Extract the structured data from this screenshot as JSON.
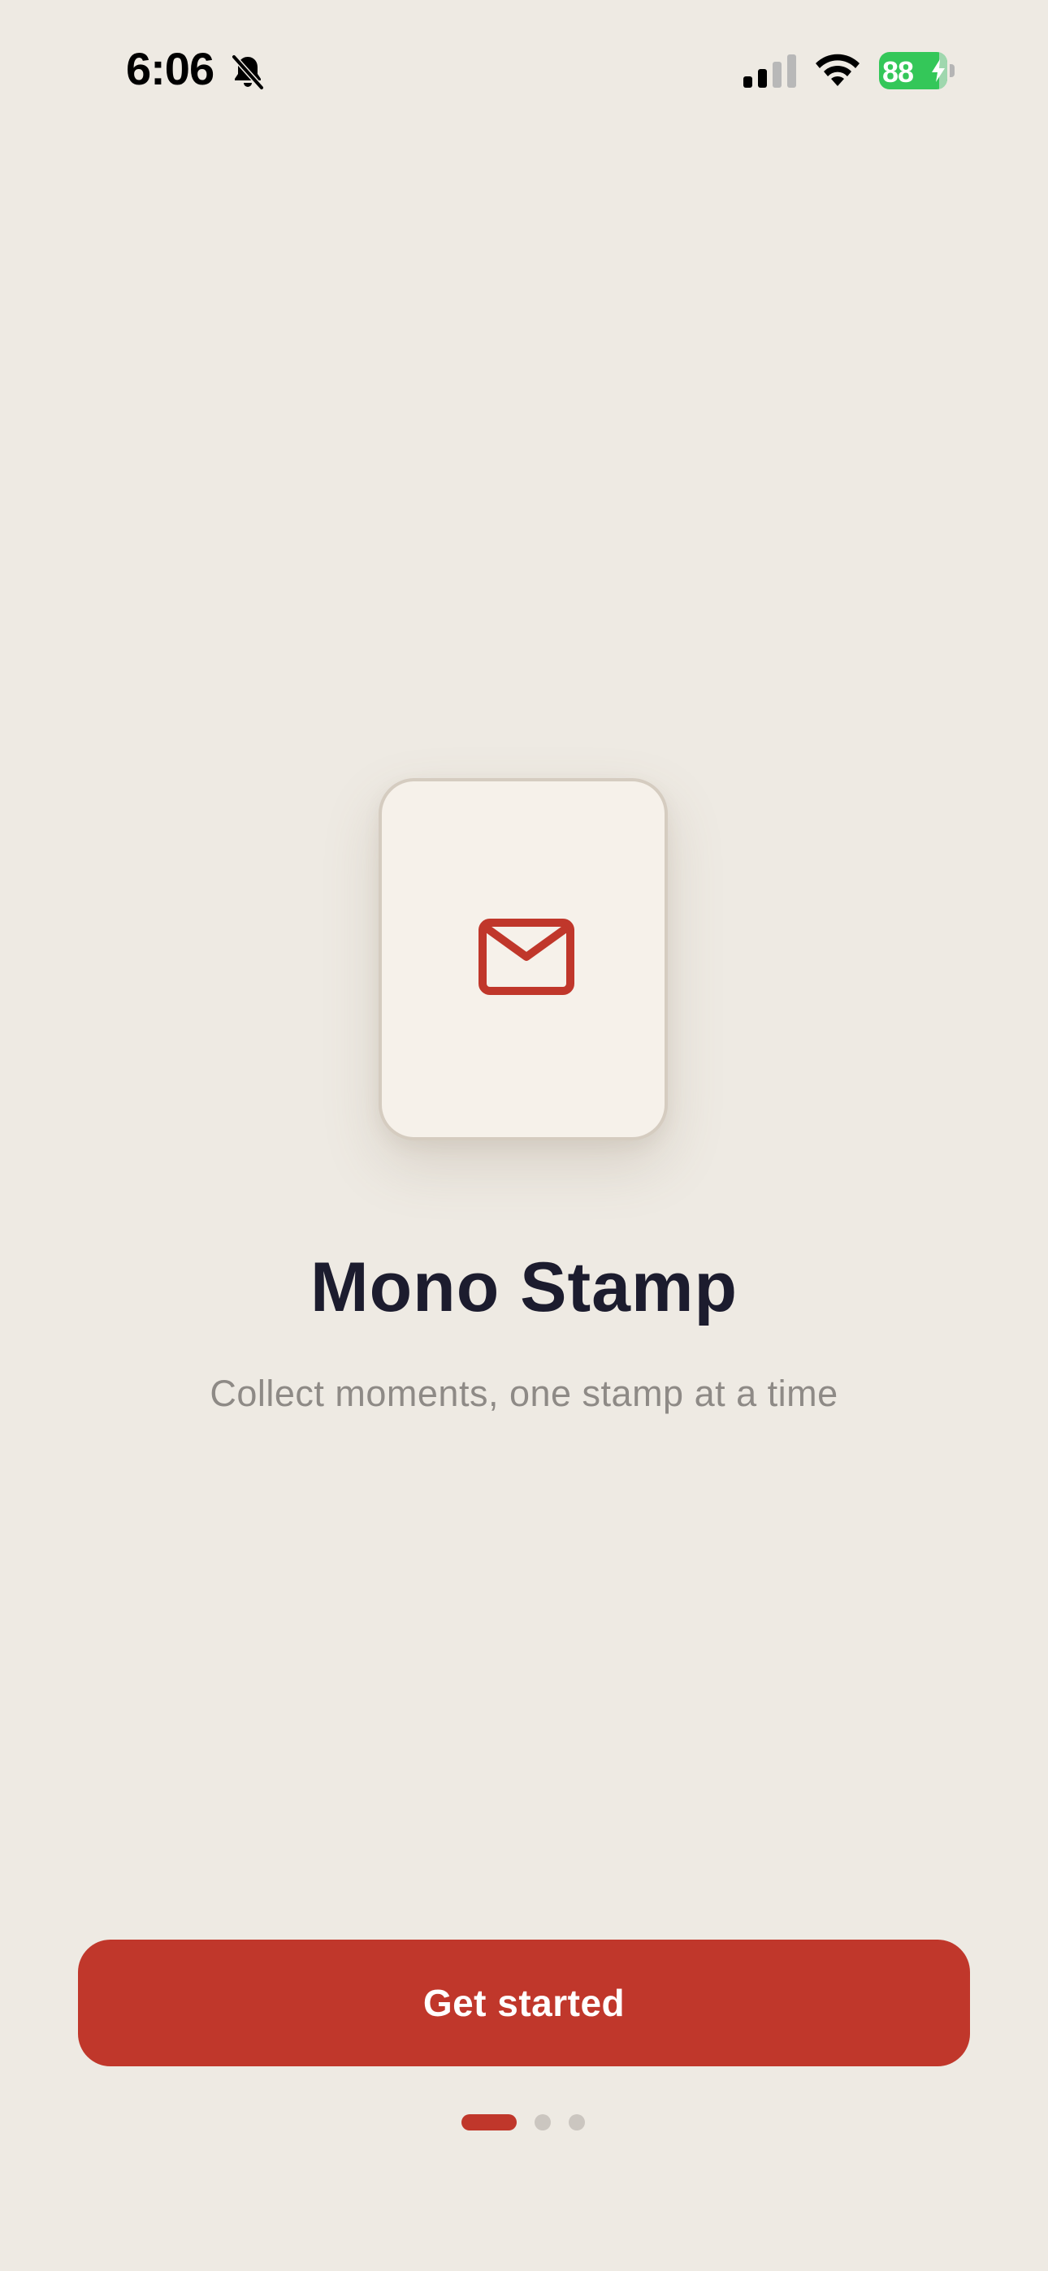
{
  "status_bar": {
    "time": "6:06",
    "battery_level": "88",
    "battery_percent": 88,
    "silent_mode": true,
    "charging": true
  },
  "stamp": {
    "icon": "mail-icon"
  },
  "onboarding": {
    "title": "Mono Stamp",
    "subtitle": "Collect moments, one stamp at a time",
    "cta_label": "Get started",
    "page_count": 3,
    "current_page": 1
  },
  "colors": {
    "background": "#EEEAE3",
    "accent": "#C0372B",
    "title": "#1C1C2E",
    "subtitle": "#8E8A86",
    "card": "#F6F1EA",
    "card_border": "#D5CCC0",
    "battery": "#34C759"
  }
}
